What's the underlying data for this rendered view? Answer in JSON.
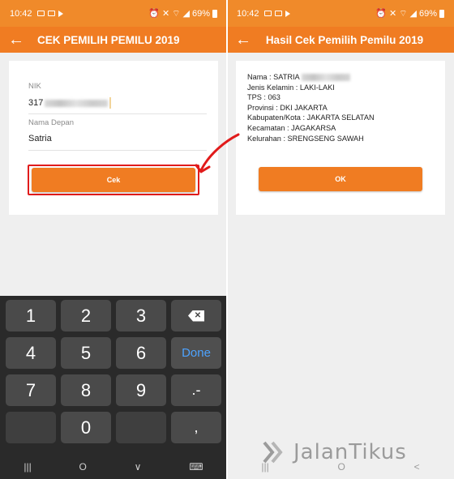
{
  "status_bar": {
    "time": "10:42",
    "battery": "69%"
  },
  "left_screen": {
    "title": "CEK PEMILIH PEMILU 2019",
    "nik": {
      "label": "NIK",
      "value": "317"
    },
    "first_name": {
      "label": "Nama Depan",
      "value": "Satria"
    },
    "cek_button": "Cek",
    "keyboard": {
      "rows": [
        [
          "1",
          "2",
          "3",
          "backspace"
        ],
        [
          "4",
          "5",
          "6",
          "Done"
        ],
        [
          "7",
          "8",
          "9",
          ".-"
        ],
        [
          "",
          "0",
          "",
          ","
        ]
      ]
    }
  },
  "right_screen": {
    "title": "Hasil Cek Pemilih Pemilu 2019",
    "lines": [
      "Nama : SATRIA",
      "Jenis Kelamin : LAKI-LAKI",
      "TPS : 063",
      "Provinsi : DKI JAKARTA",
      "Kabupaten/Kota : JAKARTA SELATAN",
      "Kecamatan : JAGAKARSA",
      "Kelurahan : SRENGSENG SAWAH"
    ],
    "ok_button": "OK"
  },
  "nav_bar": {
    "recents": "|||",
    "home": "O",
    "back": "<",
    "keyboard": "⌨"
  },
  "watermark": {
    "text": "JalanTikus"
  },
  "colors": {
    "accent": "#f07c22",
    "highlight": "#e11b1b",
    "done_text": "#4da3ff"
  }
}
